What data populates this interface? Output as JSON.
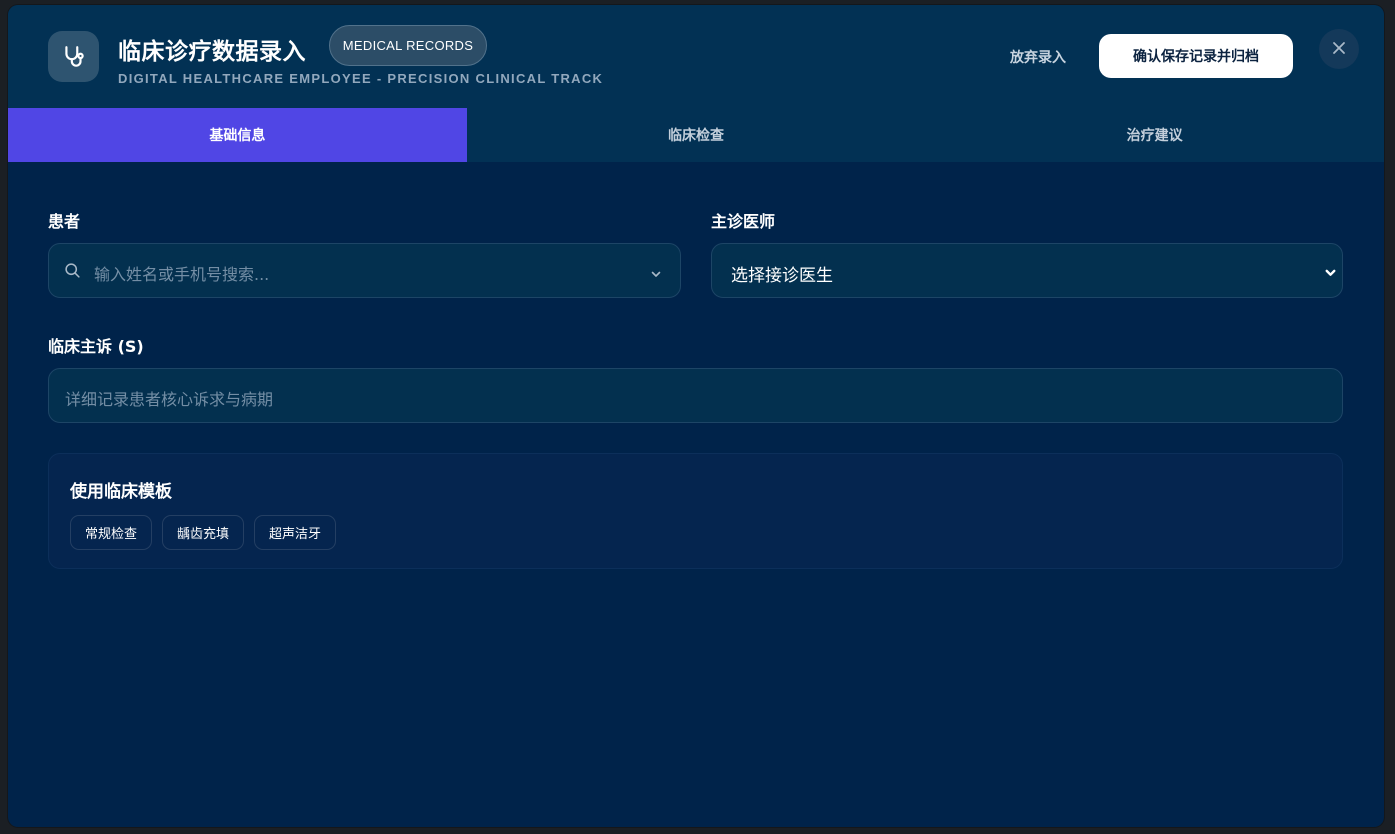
{
  "header": {
    "title": "临床诊疗数据录入",
    "badge": "MEDICAL RECORDS",
    "subtitle": "DIGITAL HEALTHCARE EMPLOYEE - PRECISION CLINICAL TRACK",
    "discard_label": "放弃录入",
    "confirm_label": "确认保存记录并归档",
    "icon": "stethoscope-icon",
    "close_icon": "close-icon"
  },
  "tabs": [
    {
      "label": "基础信息",
      "active": true
    },
    {
      "label": "临床检查",
      "active": false
    },
    {
      "label": "治疗建议",
      "active": false
    }
  ],
  "form": {
    "patient": {
      "label": "患者",
      "placeholder": "输入姓名或手机号搜索..."
    },
    "doctor": {
      "label": "主诊医师",
      "value": "选择接诊医生"
    },
    "complaint": {
      "label": "临床主诉 (S)",
      "placeholder": "详细记录患者核心诉求与病期"
    }
  },
  "templates": {
    "title": "使用临床模板",
    "items": [
      "常规检查",
      "龋齿充填",
      "超声洁牙"
    ]
  },
  "colors": {
    "modal_bg": "#00234a",
    "header_bg": "#023154",
    "accent": "#5046e5",
    "primary_button_bg": "#ffffff"
  }
}
